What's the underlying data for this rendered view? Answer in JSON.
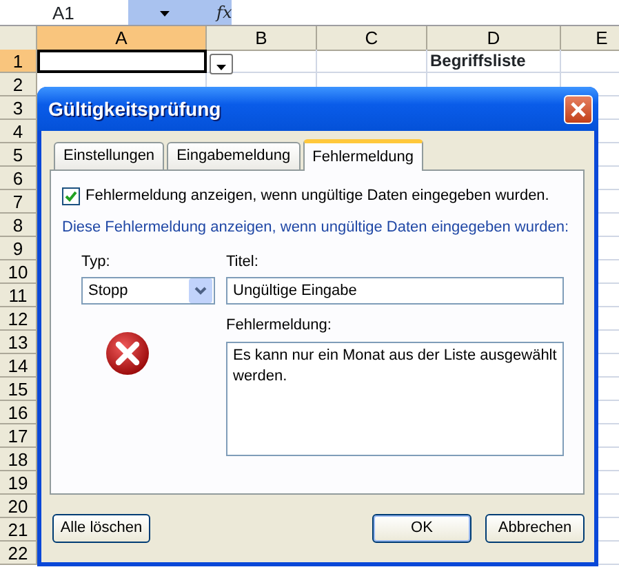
{
  "formula_bar": {
    "name_box": "A1",
    "function_label": "fx"
  },
  "sheet": {
    "columns": [
      {
        "label": "A",
        "selected": true
      },
      {
        "label": "B",
        "selected": false
      },
      {
        "label": "C",
        "selected": false
      },
      {
        "label": "D",
        "selected": false
      },
      {
        "label": "E",
        "selected": false
      }
    ],
    "rows": [
      {
        "label": "1",
        "selected": true,
        "column_d": "Begriffsliste",
        "column_d_bold": true
      },
      {
        "label": "2",
        "selected": false
      },
      {
        "label": "3",
        "selected": false
      },
      {
        "label": "4",
        "selected": false
      },
      {
        "label": "5",
        "selected": false
      },
      {
        "label": "6",
        "selected": false
      },
      {
        "label": "7",
        "selected": false
      },
      {
        "label": "8",
        "selected": false
      },
      {
        "label": "9",
        "selected": false
      },
      {
        "label": "10",
        "selected": false
      },
      {
        "label": "11",
        "selected": false
      },
      {
        "label": "12",
        "selected": false
      },
      {
        "label": "13",
        "selected": false
      },
      {
        "label": "14",
        "selected": false
      },
      {
        "label": "15",
        "selected": false
      },
      {
        "label": "16",
        "selected": false
      },
      {
        "label": "17",
        "selected": false
      },
      {
        "label": "18",
        "selected": false
      },
      {
        "label": "19",
        "selected": false
      },
      {
        "label": "20",
        "selected": false
      },
      {
        "label": "21",
        "selected": false
      },
      {
        "label": "22",
        "selected": false
      }
    ]
  },
  "dialog": {
    "title": "Gültigkeitsprüfung",
    "tabs": [
      {
        "label": "Einstellungen",
        "selected": false
      },
      {
        "label": "Eingabemeldung",
        "selected": false
      },
      {
        "label": "Fehlermeldung",
        "selected": true
      }
    ],
    "show_error_checkbox": {
      "label": "Fehlermeldung anzeigen, wenn ungültige Daten eingegeben wurden.",
      "checked": true
    },
    "hint": "Diese Fehlermeldung anzeigen, wenn ungültige Daten eingegeben wurden:",
    "type_label": "Typ:",
    "type_value": "Stopp",
    "title_label": "Titel:",
    "title_value": "Ungültige Eingabe",
    "message_label": "Fehlermeldung:",
    "message_value": "Es kann nur ein Monat aus der Liste ausgewählt werden.",
    "buttons": [
      {
        "label": "Alle löschen",
        "kind": "secondary"
      },
      {
        "label": "OK",
        "kind": "default"
      },
      {
        "label": "Abbrechen",
        "kind": "secondary"
      }
    ]
  }
}
